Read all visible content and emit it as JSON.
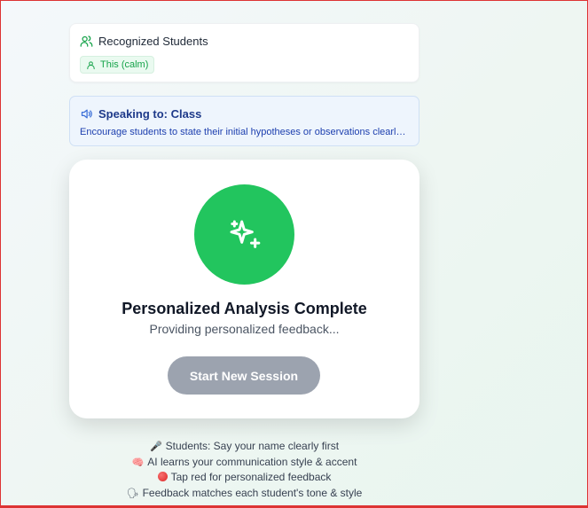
{
  "recognized": {
    "title": "Recognized Students",
    "students": [
      {
        "label": "This (calm)"
      }
    ]
  },
  "speaking": {
    "title": "Speaking to: Class",
    "message": "Encourage students to state their initial hypotheses or observations clearly, as..."
  },
  "analysis": {
    "title": "Personalized Analysis Complete",
    "subtitle": "Providing personalized feedback...",
    "button_label": "Start New Session"
  },
  "tips": [
    {
      "icon": "microphone-icon",
      "text": "Students: Say your name clearly first"
    },
    {
      "icon": "brain-icon",
      "text": "AI learns your communication style & accent"
    },
    {
      "icon": "red-dot-icon",
      "text": "Tap red for personalized feedback"
    },
    {
      "icon": "speaking-head-icon",
      "text": "Feedback matches each student's tone & style"
    }
  ],
  "colors": {
    "accent_green": "#22c55e",
    "info_blue": "#1e3a8a",
    "button_disabled": "#9ca3af"
  }
}
